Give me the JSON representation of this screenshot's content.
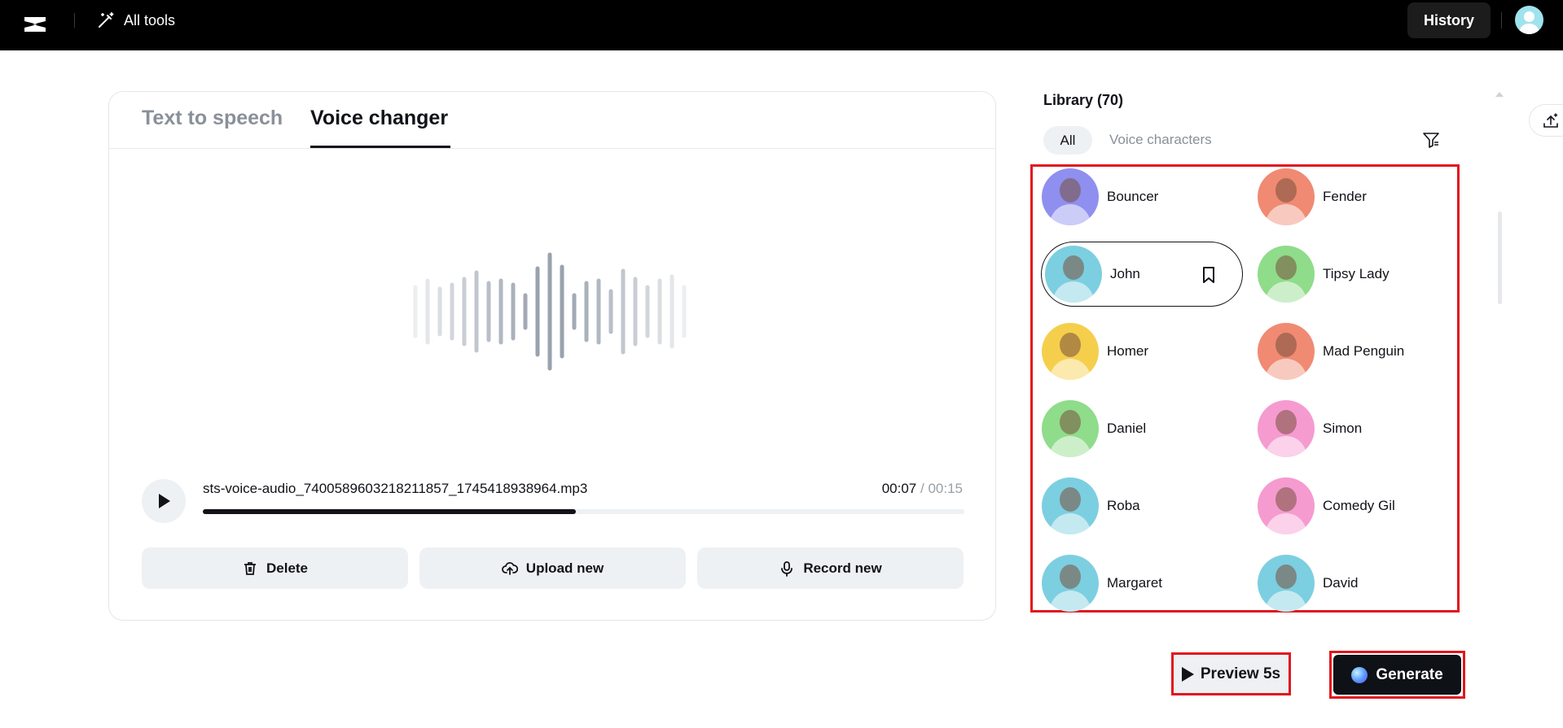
{
  "topbar": {
    "all_tools_label": "All tools",
    "history_label": "History"
  },
  "tabs": [
    {
      "label": "Text to speech"
    },
    {
      "label": "Voice changer"
    }
  ],
  "player": {
    "filename": "sts-voice-audio_7400589603218211857_1745418938964.mp3",
    "current_time": "00:07",
    "total_time": "/ 00:15",
    "progress": 0.49
  },
  "actions": {
    "delete_label": "Delete",
    "upload_label": "Upload new",
    "record_label": "Record new"
  },
  "library": {
    "title": "Library (70)",
    "filter_all": "All",
    "filter_voice_characters": "Voice characters",
    "voices": [
      {
        "name": "Bouncer",
        "bg": "#8f8ff0"
      },
      {
        "name": "Fender",
        "bg": "#f08a72"
      },
      {
        "name": "John",
        "bg": "#7ccfe0",
        "selected": true
      },
      {
        "name": "Tipsy Lady",
        "bg": "#8fdc8a"
      },
      {
        "name": "Homer",
        "bg": "#f5cf4c"
      },
      {
        "name": "Mad Penguin",
        "bg": "#f08a72"
      },
      {
        "name": "Daniel",
        "bg": "#8fdc8a"
      },
      {
        "name": "Simon",
        "bg": "#f59bd0"
      },
      {
        "name": "Roba",
        "bg": "#7ccfe0"
      },
      {
        "name": "Comedy Gil",
        "bg": "#f59bd0"
      },
      {
        "name": "Margaret",
        "bg": "#7ccfe0"
      },
      {
        "name": "David",
        "bg": "#7ccfe0"
      }
    ]
  },
  "buttons": {
    "preview_label": "Preview 5s",
    "generate_label": "Generate"
  }
}
